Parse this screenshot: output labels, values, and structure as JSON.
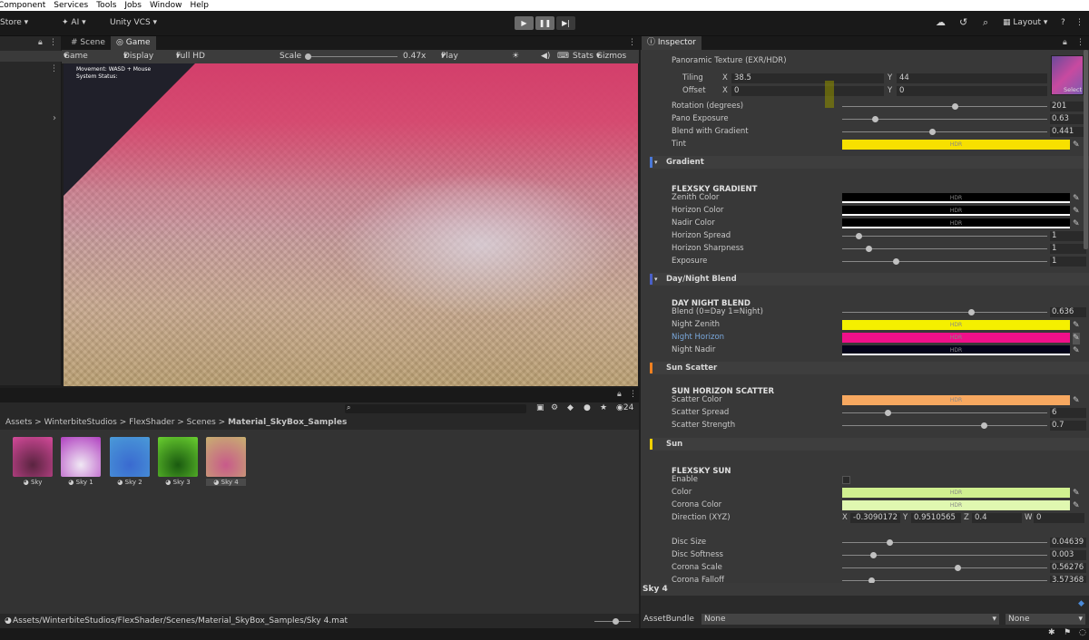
{
  "menu": [
    "Component",
    "Services",
    "Tools",
    "Jobs",
    "Window",
    "Help"
  ],
  "toolbar": {
    "store": "Store ▾",
    "ai": "AI ▾",
    "vcs": "Unity VCS ▾",
    "layout": "Layout ▾"
  },
  "tabs": {
    "scene": "Scene",
    "game": "Game",
    "inspector": "Inspector"
  },
  "gamebar": {
    "mode": "Game",
    "display": "Display 1",
    "resolution": "Full HD (1920x1080)",
    "scale_label": "Scale",
    "scale_value": "0.47x",
    "play_focused": "Play Focused",
    "stats": "Stats",
    "gizmos": "Gizmos"
  },
  "overlay": {
    "line1": "Movement: WASD + Mouse",
    "line2": "System Status:"
  },
  "project": {
    "breadcrumb": [
      "Assets",
      "WinterbiteStudios",
      "FlexShader",
      "Scenes",
      "Material_SkyBox_Samples"
    ],
    "count": "24",
    "assets": [
      {
        "name": "Sky",
        "c1": "#5a2440",
        "c2": "#d44a9a"
      },
      {
        "name": "Sky 1",
        "c1": "#f0e8f4",
        "c2": "#b040c0"
      },
      {
        "name": "Sky 2",
        "c1": "#3a6ad0",
        "c2": "#4a9ad8"
      },
      {
        "name": "Sky 3",
        "c1": "#1a5a10",
        "c2": "#6ad030"
      },
      {
        "name": "Sky 4",
        "c1": "#c85a8a",
        "c2": "#c8b070"
      }
    ],
    "status_path": "Assets/WinterbiteStudios/FlexShader/Scenes/Material_SkyBox_Samples/Sky 4.mat"
  },
  "inspector": {
    "pano_label": "Panoramic Texture (EXR/HDR)",
    "tiling_label": "Tiling",
    "tiling_x": "38.5",
    "tiling_y": "44",
    "offset_label": "Offset",
    "offset_x": "0",
    "offset_y": "0",
    "select": "Select",
    "rotation": {
      "label": "Rotation (degrees)",
      "value": "201",
      "pos": 0.55
    },
    "pano_exposure": {
      "label": "Pano Exposure",
      "value": "0.63",
      "pos": 0.16
    },
    "blend_gradient": {
      "label": "Blend with Gradient",
      "value": "0.441",
      "pos": 0.44
    },
    "tint_label": "Tint",
    "gradient_section": "Gradient",
    "gradient_hdr": "FLEXSKY GRADIENT",
    "zenith_label": "Zenith Color",
    "horizon_label": "Horizon Color",
    "nadir_label": "Nadir Color",
    "horizon_spread": {
      "label": "Horizon Spread",
      "value": "1",
      "pos": 0.08
    },
    "horizon_sharp": {
      "label": "Horizon Sharpness",
      "value": "1",
      "pos": 0.13
    },
    "exposure": {
      "label": "Exposure",
      "value": "1",
      "pos": 0.26
    },
    "daynight_section": "Day/Night Blend",
    "daynight_hdr": "DAY NIGHT BLEND",
    "blend_dn": {
      "label": "Blend (0=Day  1=Night)",
      "value": "0.636",
      "pos": 0.63
    },
    "night_zenith": "Night Zenith",
    "night_horizon": "Night Horizon",
    "night_nadir": "Night Nadir",
    "scatter_section": "Sun Scatter",
    "scatter_hdr": "SUN HORIZON SCATTER",
    "scatter_color": "Scatter Color",
    "scatter_spread": {
      "label": "Scatter Spread",
      "value": "6",
      "pos": 0.22
    },
    "scatter_strength": {
      "label": "Scatter Strength",
      "value": "0.7",
      "pos": 0.69
    },
    "sun_section": "Sun",
    "sun_hdr": "FLEXSKY SUN",
    "enable": "Enable",
    "color_label": "Color",
    "corona_label": "Corona Color",
    "direction_label": "Direction (XYZ)",
    "dir_x": "-0.3090172",
    "dir_y": "0.9510565",
    "dir_z": "0.4",
    "dir_w": "0",
    "disc_size": {
      "label": "Disc Size",
      "value": "0.04639",
      "pos": 0.23
    },
    "disc_soft": {
      "label": "Disc Softness",
      "value": "0.003",
      "pos": 0.15
    },
    "corona_scale": {
      "label": "Corona Scale",
      "value": "0.56276",
      "pos": 0.56
    },
    "corona_falloff": {
      "label": "Corona Falloff",
      "value": "3.57368",
      "pos": 0.14
    },
    "hdr": "HDR",
    "x": "X",
    "y": "Y",
    "z": "Z",
    "w": "W"
  },
  "footer": {
    "asset_name": "Sky 4",
    "bundle_label": "AssetBundle",
    "bundle_value": "None",
    "bundle_variant": "None"
  },
  "colors": {
    "tint": "#f7e000",
    "night_zenith": "#f5f000",
    "night_horizon": "#f0108a",
    "night_nadir": "#04041a",
    "scatter": "#f7a860",
    "sun_color": "#d0f090",
    "corona": "#e0f8b0",
    "section_gradient": "#4a78d8",
    "section_daynight": "#4a60c8",
    "section_scatter": "#f08020",
    "section_sun": "#f0d000"
  }
}
